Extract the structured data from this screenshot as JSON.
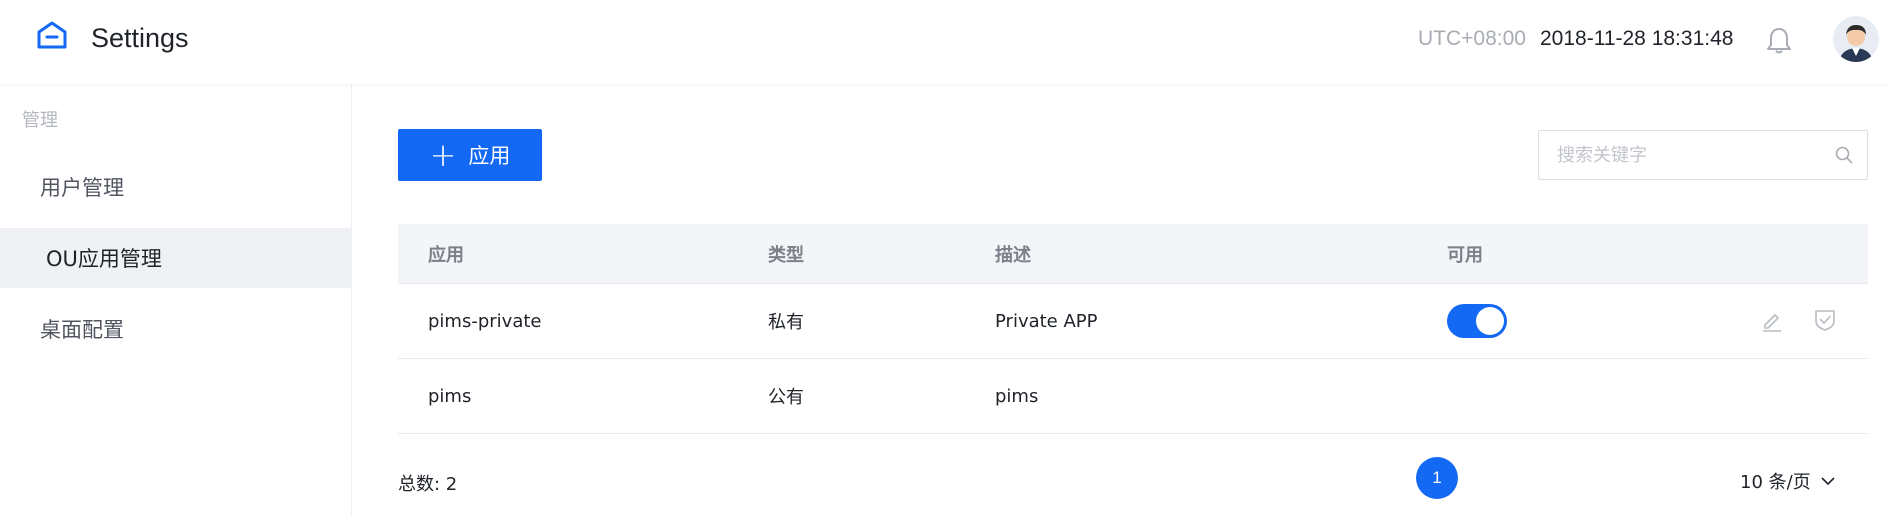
{
  "header": {
    "title": "Settings",
    "timezone": "UTC+08:00",
    "datetime": "2018-11-28 18:31:48"
  },
  "sidebar": {
    "group_label": "管理",
    "items": [
      {
        "label": "用户管理"
      },
      {
        "label": "OU应用管理"
      },
      {
        "label": "桌面配置"
      }
    ]
  },
  "toolbar": {
    "add_label": "应用",
    "search_placeholder": "搜索关键字"
  },
  "table": {
    "columns": [
      "应用",
      "类型",
      "描述",
      "可用"
    ],
    "rows": [
      {
        "app": "pims-private",
        "type": "私有",
        "desc": "Private APP",
        "enabled": true
      },
      {
        "app": "pims",
        "type": "公有",
        "desc": "pims"
      }
    ]
  },
  "pagination": {
    "total": "总数: 2",
    "current_page": "1",
    "page_size": "10 条/页"
  },
  "colors": {
    "accent": "#1469f4",
    "background": "#f0f1f4"
  }
}
